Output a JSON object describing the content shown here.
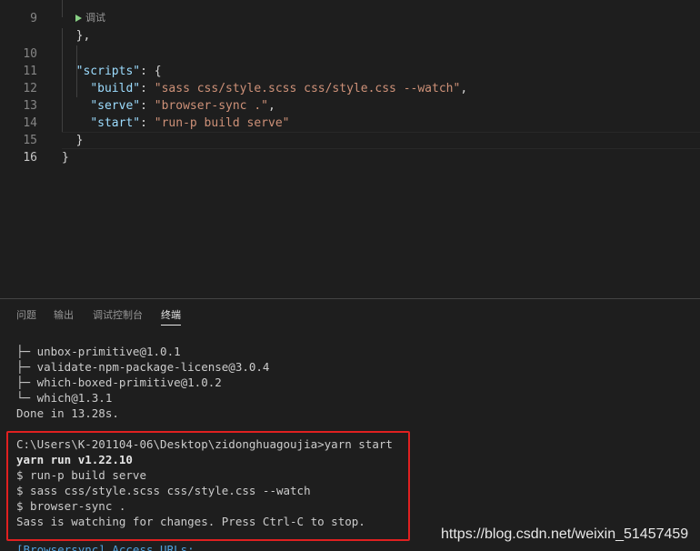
{
  "editor": {
    "codelens_label": "调试",
    "lines": [
      {
        "num": "9",
        "text": "  },"
      },
      {
        "num": "10",
        "text": "  \"scripts\": {"
      },
      {
        "num": "11",
        "text": "    \"build\": \"sass css/style.scss css/style.css --watch\","
      },
      {
        "num": "12",
        "text": "    \"serve\": \"browser-sync .\","
      },
      {
        "num": "13",
        "text": "    \"start\": \"run-p build serve\""
      },
      {
        "num": "14",
        "text": "  }"
      },
      {
        "num": "15",
        "text": "}"
      },
      {
        "num": "16",
        "text": ""
      }
    ],
    "colors": {
      "key": "#9cdcfe",
      "string": "#ce9178",
      "background": "#1e1e1e"
    }
  },
  "panel": {
    "tabs": [
      {
        "label": "问题",
        "active": false
      },
      {
        "label": "输出",
        "active": false
      },
      {
        "label": "调试控制台",
        "active": false
      },
      {
        "label": "终端",
        "active": true
      }
    ],
    "terminal_lines": [
      "├─ unbox-primitive@1.0.1",
      "├─ validate-npm-package-license@3.0.4",
      "├─ which-boxed-primitive@1.0.2",
      "└─ which@1.3.1",
      "Done in 13.28s.",
      "",
      "C:\\Users\\K-201104-06\\Desktop\\zidonghuagoujia>yarn start",
      "yarn run v1.22.10",
      "$ run-p build serve",
      "$ sass css/style.scss css/style.css --watch",
      "$ browser-sync .",
      "Sass is watching for changes. Press Ctrl-C to stop.",
      "",
      "[Browsersync] Access URLs:"
    ],
    "highlight_color": "#e02020"
  },
  "watermark": "https://blog.csdn.net/weixin_51457459"
}
